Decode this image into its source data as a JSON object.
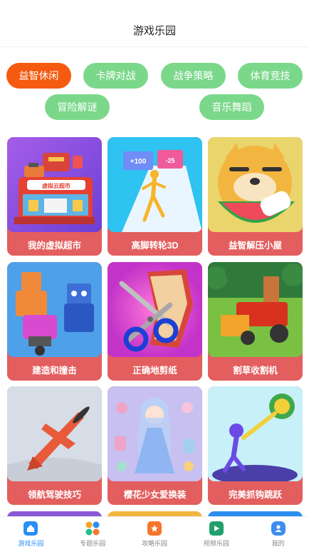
{
  "header": {
    "title": "游戏乐园"
  },
  "categories": [
    {
      "label": "益智休闲",
      "active": true
    },
    {
      "label": "卡牌对战",
      "active": false
    },
    {
      "label": "战争策略",
      "active": false
    },
    {
      "label": "体育竞技",
      "active": false
    },
    {
      "label": "冒险解谜",
      "active": false
    },
    {
      "label": "音乐舞蹈",
      "active": false
    }
  ],
  "games": [
    {
      "label": "我的虚拟超市",
      "icon": "supermarket-icon",
      "sign_text": "虚拟云超市"
    },
    {
      "label": "高脚转轮3D",
      "icon": "runner-icon",
      "gate_left": "+100",
      "gate_right": "-25"
    },
    {
      "label": "益智解压小屋",
      "icon": "dog-watermelon-icon"
    },
    {
      "label": "建造和撞击",
      "icon": "robots-icon"
    },
    {
      "label": "正确地剪纸",
      "icon": "scissors-icon"
    },
    {
      "label": "割草收割机",
      "icon": "harvester-icon"
    },
    {
      "label": "领航驾驶技巧",
      "icon": "airplane-icon"
    },
    {
      "label": "樱花少女爱换装",
      "icon": "dress-up-girl-icon"
    },
    {
      "label": "完美抓钩跳跃",
      "icon": "grapple-hook-icon"
    }
  ],
  "tabs": [
    {
      "label": "游戏乐园",
      "icon": "home-icon",
      "active": true,
      "color": "#2a8ef5"
    },
    {
      "label": "专题乐园",
      "icon": "grid-icon",
      "active": false,
      "color": "#f5a623"
    },
    {
      "label": "攻略乐园",
      "icon": "star-icon",
      "active": false,
      "color": "#f5762a"
    },
    {
      "label": "视频乐园",
      "icon": "play-icon",
      "active": false,
      "color": "#22a06b"
    },
    {
      "label": "我的",
      "icon": "profile-icon",
      "active": false,
      "color": "#3d8ef0"
    }
  ],
  "colors": {
    "accent": "#f45a10",
    "chip": "#7bd88b",
    "card_label_bg": "#e35e5e",
    "tab_active": "#2a8ef5"
  }
}
